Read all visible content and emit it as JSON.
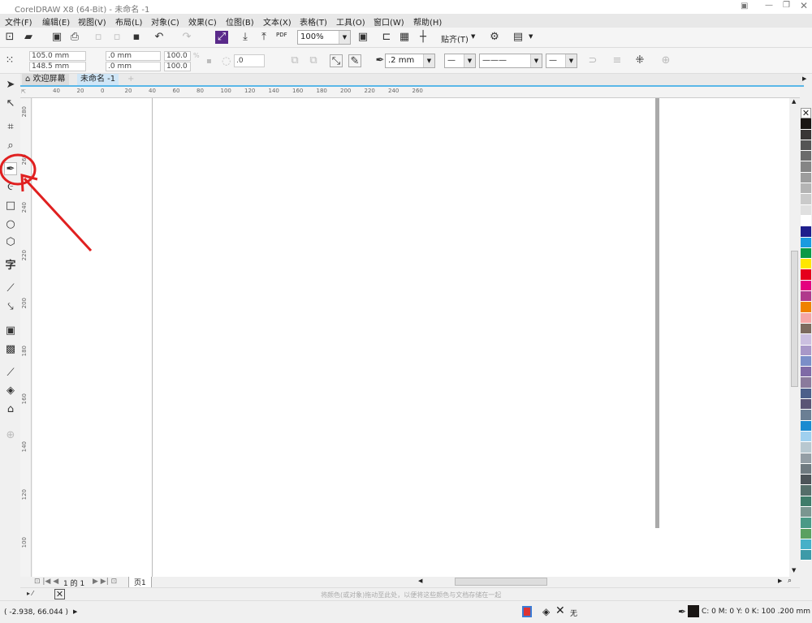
{
  "title": "CorelDRAW X8 (64-Bit) - 未命名 -1",
  "menu": [
    "文件(F)",
    "编辑(E)",
    "视图(V)",
    "布局(L)",
    "对象(C)",
    "效果(C)",
    "位图(B)",
    "文本(X)",
    "表格(T)",
    "工具(O)",
    "窗口(W)",
    "帮助(H)"
  ],
  "toolbar": {
    "zoom": "100%",
    "snap": "贴齐(T)",
    "pdf": "PDF"
  },
  "property_bar": {
    "x": "105.0 mm",
    "y": "148.5 mm",
    "w": ".0 mm",
    "h": ".0 mm",
    "sx": "100.0",
    "sy": "100.0",
    "pct": "%",
    "angle": ".0",
    "outline": ".2 mm"
  },
  "tabs": {
    "welcome": "欢迎屏幕",
    "doc": "未命名 -1"
  },
  "ruler": {
    "h": [
      "40",
      "20",
      "0",
      "20",
      "40",
      "60",
      "80",
      "100",
      "120",
      "140",
      "160",
      "180",
      "200",
      "220",
      "240",
      "260"
    ],
    "v": [
      "280",
      "260",
      "240",
      "220",
      "200",
      "180",
      "160",
      "140",
      "120",
      "100"
    ],
    "unit": "mm"
  },
  "pagebar": {
    "count": "1 的 1",
    "page": "页1"
  },
  "colorbar_hint": "将颜色(或对象)拖动至此处，以便将这些颜色与文档存储在一起",
  "status": {
    "coords": "( -2.938, 66.044 )",
    "fill": "无",
    "outline": "C: 0 M: 0 Y: 0 K: 100  .200 mm"
  },
  "palette": [
    "#1a1614",
    "#3a3635",
    "#555",
    "#6b6b6b",
    "#858585",
    "#9d9d9d",
    "#b4b4b4",
    "#cacaca",
    "#e0e0e0",
    "#ffffff",
    "#1e1e8c",
    "#1a9be0",
    "#0a9a46",
    "#ffe600",
    "#e5001b",
    "#e4007f",
    "#b03a8c",
    "#ef8200",
    "#f4a6a6",
    "#7d6b5f",
    "#cbbfe0",
    "#a897c8",
    "#7b8ec8",
    "#7f6aa6",
    "#8a7a9c",
    "#4c5f8a",
    "#5a5475",
    "#6b7f94",
    "#1a8ad0",
    "#9fd0ef",
    "#b8c8d0",
    "#949ea5",
    "#6f7a80",
    "#4d5459",
    "#556e6a",
    "#3f7c6a",
    "#7a9690",
    "#4a9a86",
    "#5aa060",
    "#47b0c8",
    "#3d9aa8"
  ],
  "accent": "#5ab7e8",
  "annotation": "#e02020"
}
